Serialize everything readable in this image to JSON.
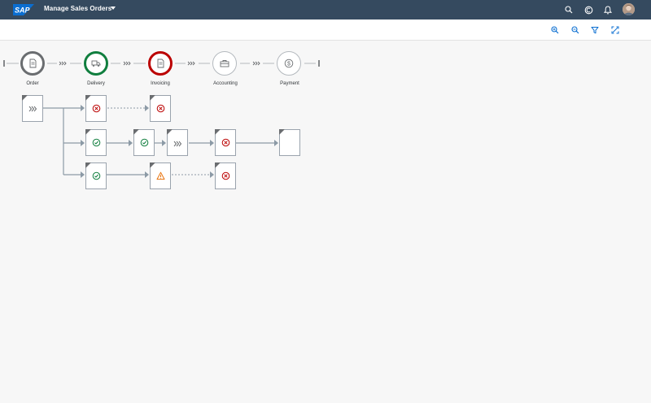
{
  "shell": {
    "logo_text": "SAP",
    "app_title": "Manage Sales Orders",
    "icons": [
      "search-icon",
      "copilot-icon",
      "notifications-icon"
    ],
    "brand_color": "#354a5f"
  },
  "toolbar": {
    "icons": [
      "zoom-in-icon",
      "zoom-out-icon",
      "filter-icon",
      "fullscreen-icon"
    ],
    "accent_color": "#0a6ed1"
  },
  "lanes": [
    {
      "label": "Order",
      "icon": "document-icon",
      "status": "neutral",
      "ring_color": "#6a6d70"
    },
    {
      "label": "Delivery",
      "icon": "truck-icon",
      "status": "positive",
      "ring_color": "#107e3e"
    },
    {
      "label": "Invoicing",
      "icon": "document-icon",
      "status": "negative",
      "ring_color": "#bb0000"
    },
    {
      "label": "Accounting",
      "icon": "briefcase-icon",
      "status": "none",
      "ring_color": "#b4b9be"
    },
    {
      "label": "Payment",
      "icon": "dollar-icon",
      "status": "none",
      "ring_color": "#b4b9be"
    }
  ],
  "nodes": [
    {
      "id": "order-1",
      "status": "in-progress",
      "icon": "chevrons-icon"
    },
    {
      "id": "delivery-1",
      "status": "error",
      "icon": "error-icon"
    },
    {
      "id": "invoice-1",
      "status": "error",
      "icon": "error-icon"
    },
    {
      "id": "delivery-2",
      "status": "success",
      "icon": "success-icon"
    },
    {
      "id": "invoice-2a",
      "status": "success",
      "icon": "success-icon"
    },
    {
      "id": "invoice-2b",
      "status": "in-progress",
      "icon": "chevrons-icon"
    },
    {
      "id": "accounting-2",
      "status": "error",
      "icon": "error-icon"
    },
    {
      "id": "payment-2",
      "status": "planned",
      "icon": "none"
    },
    {
      "id": "delivery-3",
      "status": "success",
      "icon": "success-icon"
    },
    {
      "id": "invoice-3",
      "status": "warning",
      "icon": "warning-icon"
    },
    {
      "id": "accounting-3",
      "status": "error",
      "icon": "error-icon"
    }
  ],
  "status_colors": {
    "error": "#bb0000",
    "success": "#107e3e",
    "warning": "#e9730c",
    "neutral": "#6a6d70"
  }
}
